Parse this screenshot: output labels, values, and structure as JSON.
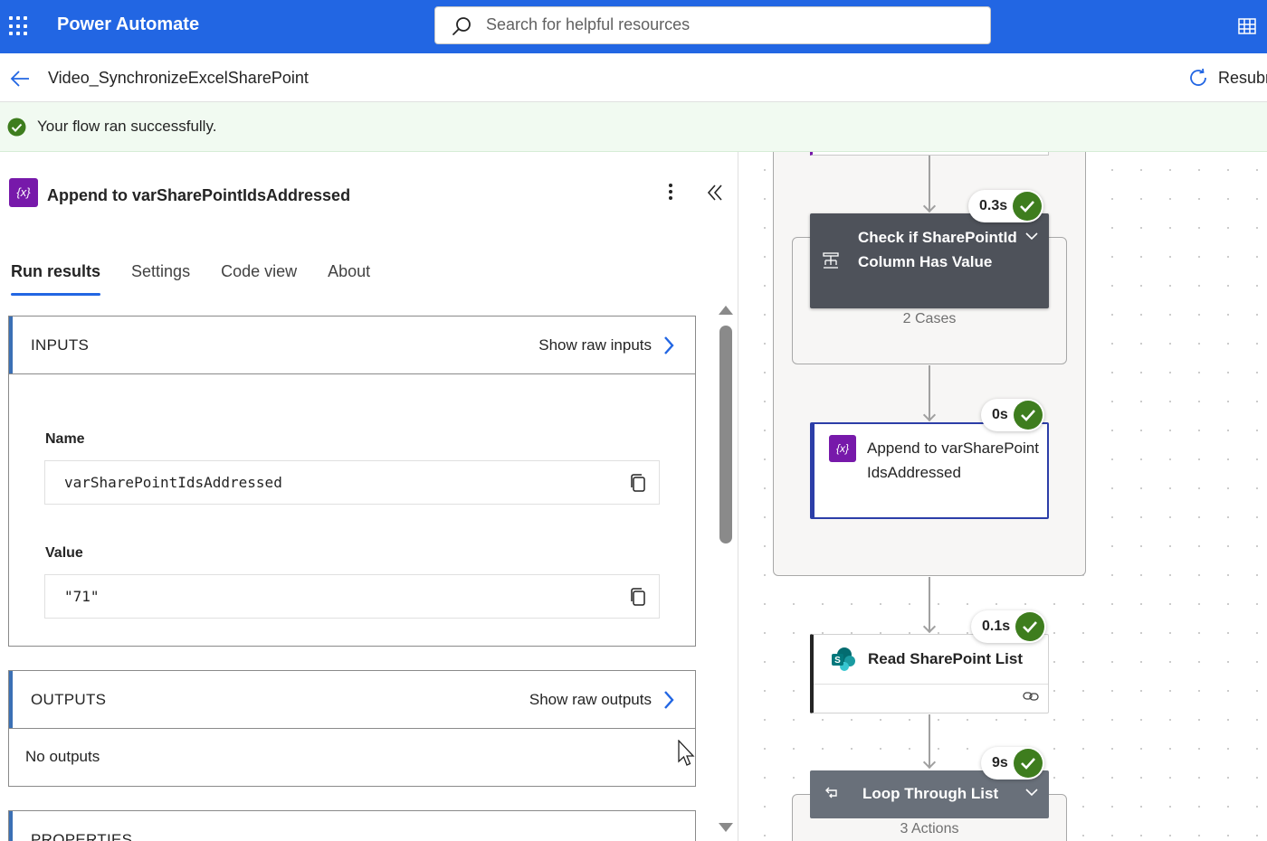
{
  "app": {
    "brand": "Power Automate"
  },
  "search": {
    "placeholder": "Search for helpful resources"
  },
  "flow": {
    "name": "Video_SynchronizeExcelSharePoint",
    "resubmit_label": "Resubmit"
  },
  "banner": {
    "message": "Your flow ran successfully."
  },
  "panel": {
    "title": "Append to varSharePointIdsAddressed",
    "icon_text": "{x}",
    "tabs": [
      {
        "label": "Run results",
        "active": true
      },
      {
        "label": "Settings",
        "active": false
      },
      {
        "label": "Code view",
        "active": false
      },
      {
        "label": "About",
        "active": false
      }
    ],
    "inputs": {
      "heading": "INPUTS",
      "raw_label": "Show raw inputs",
      "fields": [
        {
          "label": "Name",
          "value": "varSharePointIdsAddressed"
        },
        {
          "label": "Value",
          "value": "\"71\""
        }
      ]
    },
    "outputs": {
      "heading": "OUTPUTS",
      "raw_label": "Show raw outputs",
      "empty_text": "No outputs"
    },
    "properties": {
      "heading": "PROPERTIES"
    }
  },
  "canvas": {
    "condition": {
      "title": "Check if SharePointId Column Has Value",
      "duration": "0.3s",
      "subtitle": "2 Cases"
    },
    "append": {
      "title": "Append to varSharePointIdsAddressed",
      "duration": "0s",
      "icon_text": "{x}"
    },
    "read": {
      "title": "Read SharePoint List",
      "duration": "0.1s"
    },
    "loop": {
      "title": "Loop Through List",
      "duration": "9s",
      "subtitle": "3 Actions"
    }
  },
  "colors": {
    "brand": "#2266e3",
    "success": "#3e7d1e",
    "variable": "#7719aa",
    "selected": "#2c3ea8"
  }
}
